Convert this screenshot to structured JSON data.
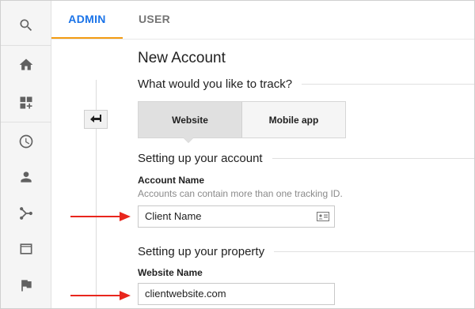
{
  "tabs": {
    "admin": "ADMIN",
    "user": "USER"
  },
  "rail": {
    "icons": [
      "search-icon",
      "home-icon",
      "dashboard-add-icon",
      "clock-icon",
      "person-icon",
      "share-icon",
      "browser-window-icon",
      "flag-icon"
    ]
  },
  "page": {
    "title": "New Account",
    "track_question": "What would you like to track?",
    "options": {
      "website": "Website",
      "mobile": "Mobile app",
      "selected": "Website"
    },
    "account_section": "Setting up your account",
    "account_name_label": "Account Name",
    "account_name_help": "Accounts can contain more than one tracking ID.",
    "account_name_value": "Client Name",
    "property_section": "Setting up your property",
    "website_name_label": "Website Name",
    "website_name_value": "clientwebsite.com"
  },
  "colors": {
    "accent_blue": "#1a73e8",
    "tab_underline": "#f39c12",
    "arrow_red": "#e8261d"
  }
}
